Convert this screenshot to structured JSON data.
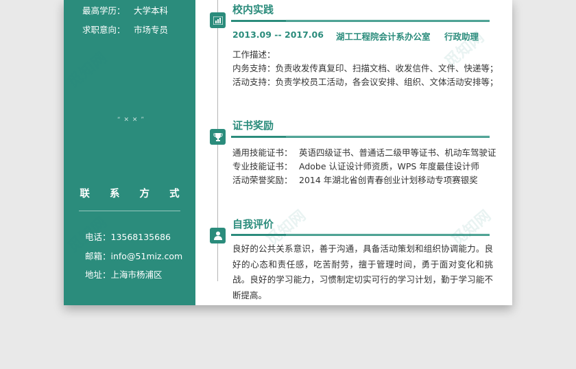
{
  "colors": {
    "accent": "#2b8c7c",
    "sidebar_text": "#ffffff",
    "body_text": "#333333"
  },
  "sidebar": {
    "education_label": "最高学历：",
    "education_value": "大学本科",
    "job_intent_label": "求职意向：",
    "job_intent_value": "市场专员",
    "decoration": "“ ✕ ✕ ”",
    "contact_title": "联 系 方 式",
    "phone": "电话：13568135686",
    "email": "邮箱：info@51miz.com",
    "address": "地址：上海市杨浦区"
  },
  "practice": {
    "icon": "bar-chart-icon",
    "title": "校内实践",
    "period": "2013.09 -- 2017.06",
    "organization": "湖工工程院会计系办公室",
    "position": "行政助理",
    "desc_label": "工作描述：",
    "desc_line1": "内务支持：负责收发传真复印、扫描文档、收发信件、文件、快递等；",
    "desc_line2": "活动支持：负责学校员工活动，各会议安排、组织、文体活动安排等；"
  },
  "certificates": {
    "icon": "trophy-icon",
    "title": "证书奖励",
    "items": [
      {
        "label": "通用技能证书：",
        "value": "英语四级证书、普通话二级甲等证书、机动车驾驶证"
      },
      {
        "label": "专业技能证书：",
        "value": "Adobe 认证设计师资质，WPS 年度最佳设计师"
      },
      {
        "label": "活动荣誉奖励：",
        "value": "2014 年湖北省创青春创业计划移动专项赛银奖"
      }
    ]
  },
  "self_eval": {
    "icon": "user-icon",
    "title": "自我评价",
    "text": "良好的公共关系意识，善于沟通，具备活动策划和组织协调能力。良好的心态和责任感，吃苦耐劳，擅于管理时间，勇于面对变化和挑战。良好的学习能力，习惯制定切实可行的学习计划，勤于学习能不断提高。"
  },
  "watermark": "觅知网"
}
